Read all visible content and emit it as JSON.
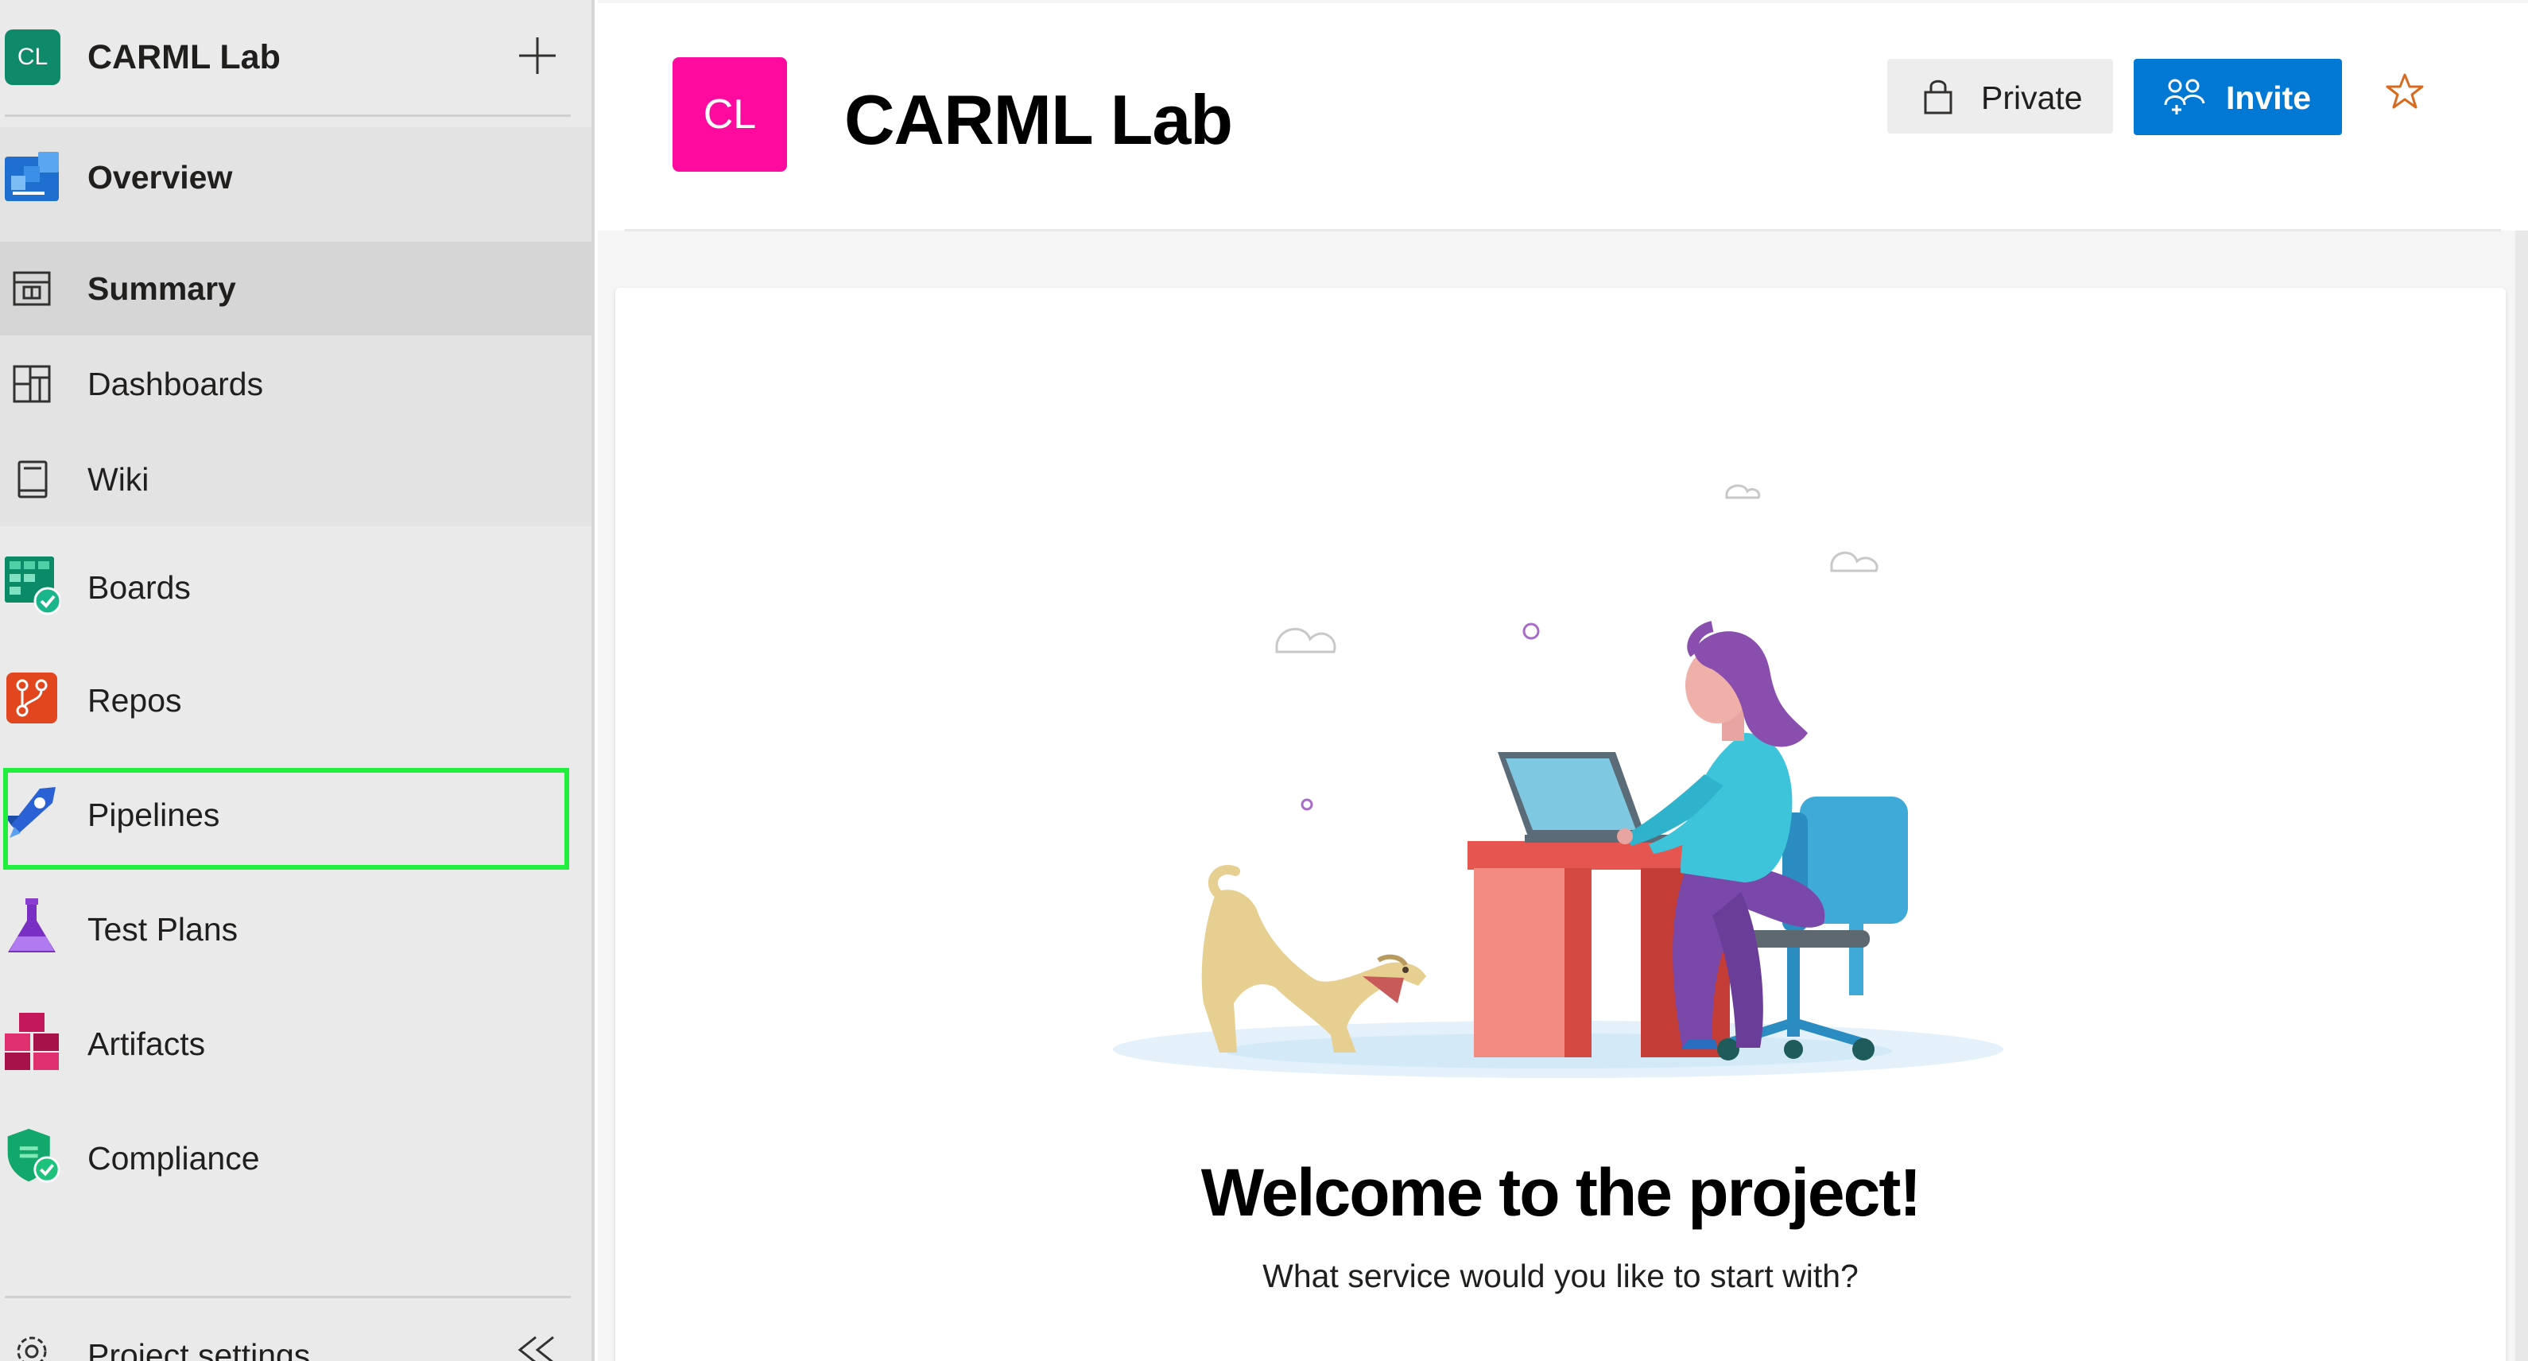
{
  "project": {
    "initials": "CL",
    "name": "CARML Lab"
  },
  "sidebar": {
    "items": [
      {
        "label": "Overview",
        "icon": "overview-icon"
      },
      {
        "label": "Summary",
        "icon": "summary-icon"
      },
      {
        "label": "Dashboards",
        "icon": "dashboards-icon"
      },
      {
        "label": "Wiki",
        "icon": "wiki-icon"
      },
      {
        "label": "Boards",
        "icon": "boards-icon"
      },
      {
        "label": "Repos",
        "icon": "repos-icon"
      },
      {
        "label": "Pipelines",
        "icon": "pipelines-icon"
      },
      {
        "label": "Test Plans",
        "icon": "test-plans-icon"
      },
      {
        "label": "Artifacts",
        "icon": "artifacts-icon"
      },
      {
        "label": "Compliance",
        "icon": "compliance-icon"
      }
    ],
    "settings_label": "Project settings",
    "highlighted_item": "Pipelines"
  },
  "header": {
    "title": "CARML Lab",
    "private_label": "Private",
    "invite_label": "Invite"
  },
  "welcome": {
    "title": "Welcome to the project!",
    "subtitle": "What service would you like to start with?"
  },
  "colors": {
    "accent": "#0078d4",
    "project_avatar": "#ff0a9e",
    "highlight": "#22ee3e",
    "star": "#d86a1f"
  }
}
